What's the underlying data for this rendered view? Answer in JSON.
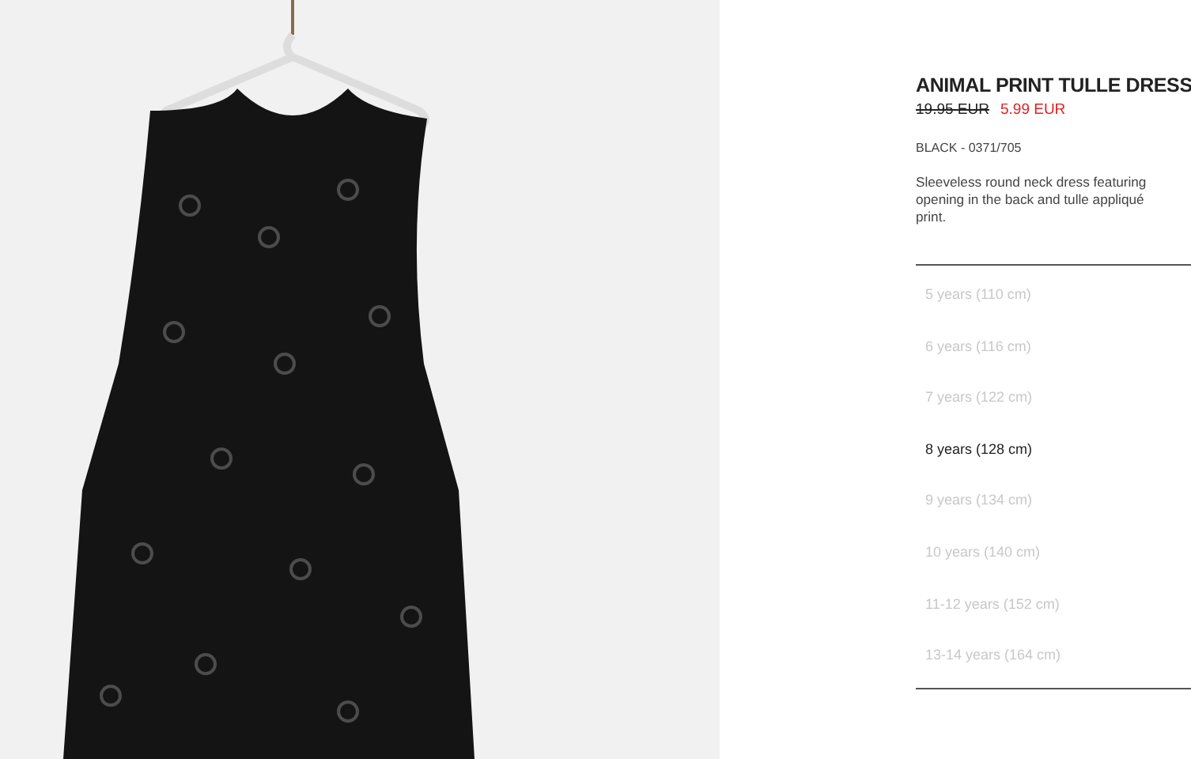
{
  "product": {
    "title": "ANIMAL PRINT TULLE DRESS",
    "old_price": "19.95 EUR",
    "price": "5.99 EUR",
    "color_ref": "BLACK - 0371/705",
    "description": [
      "Sleeveless round neck dress featuring",
      "opening in the back and tulle appliqué",
      "print."
    ]
  },
  "sizes": [
    {
      "label": "5 years (110 cm)",
      "disabled": true
    },
    {
      "label": "6 years (116 cm)",
      "disabled": true
    },
    {
      "label": "7 years (122 cm)",
      "disabled": true
    },
    {
      "label": "8 years (128 cm)",
      "disabled": false
    },
    {
      "label": "9 years (134 cm)",
      "disabled": true
    },
    {
      "label": "10 years (140 cm)",
      "disabled": true
    },
    {
      "label": "11-12 years (152 cm)",
      "disabled": true
    },
    {
      "label": "13-14 years (164 cm)",
      "disabled": true
    }
  ]
}
